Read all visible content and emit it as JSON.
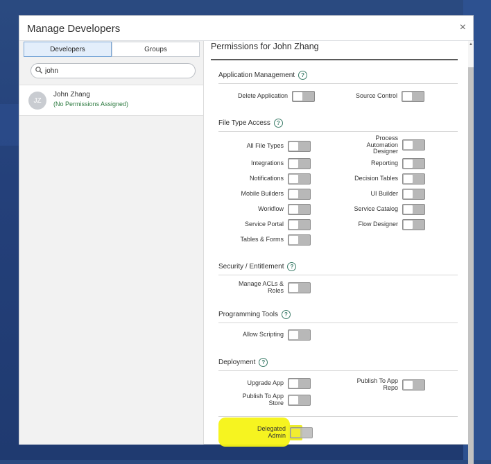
{
  "modal": {
    "title": "Manage Developers"
  },
  "tabs": [
    {
      "label": "Developers"
    },
    {
      "label": "Groups"
    }
  ],
  "search": {
    "value": "john"
  },
  "user": {
    "initials": "JZ",
    "name": "John Zhang",
    "status": "(No Permissions Assigned)"
  },
  "permissions": {
    "title": "Permissions for John Zhang",
    "sections": {
      "app_mgmt": {
        "title": "Application Management",
        "delete_application": "Delete Application",
        "source_control": "Source Control"
      },
      "file_type": {
        "title": "File Type Access",
        "all_file_types": "All File Types",
        "process_automation_designer": "Process Automation Designer",
        "integrations": "Integrations",
        "reporting": "Reporting",
        "notifications": "Notifications",
        "decision_tables": "Decision Tables",
        "mobile_builders": "Mobile Builders",
        "ui_builder": "UI Builder",
        "workflow": "Workflow",
        "service_catalog": "Service Catalog",
        "service_portal": "Service Portal",
        "flow_designer": "Flow Designer",
        "tables_forms": "Tables & Forms"
      },
      "security": {
        "title": "Security / Entitlement",
        "manage_acls": "Manage ACLs & Roles"
      },
      "programming": {
        "title": "Programming Tools",
        "allow_scripting": "Allow Scripting"
      },
      "deployment": {
        "title": "Deployment",
        "upgrade_app": "Upgrade App",
        "publish_repo": "Publish To App Repo",
        "publish_store": "Publish To App Store"
      },
      "delegated": {
        "delegated_admin": "Delegated Admin"
      }
    }
  },
  "colors": {
    "highlight": "#f6f314",
    "toggle_off": "#b8b8b8",
    "status_green": "#2c7a3f",
    "active_tab": "#e3eefb"
  }
}
